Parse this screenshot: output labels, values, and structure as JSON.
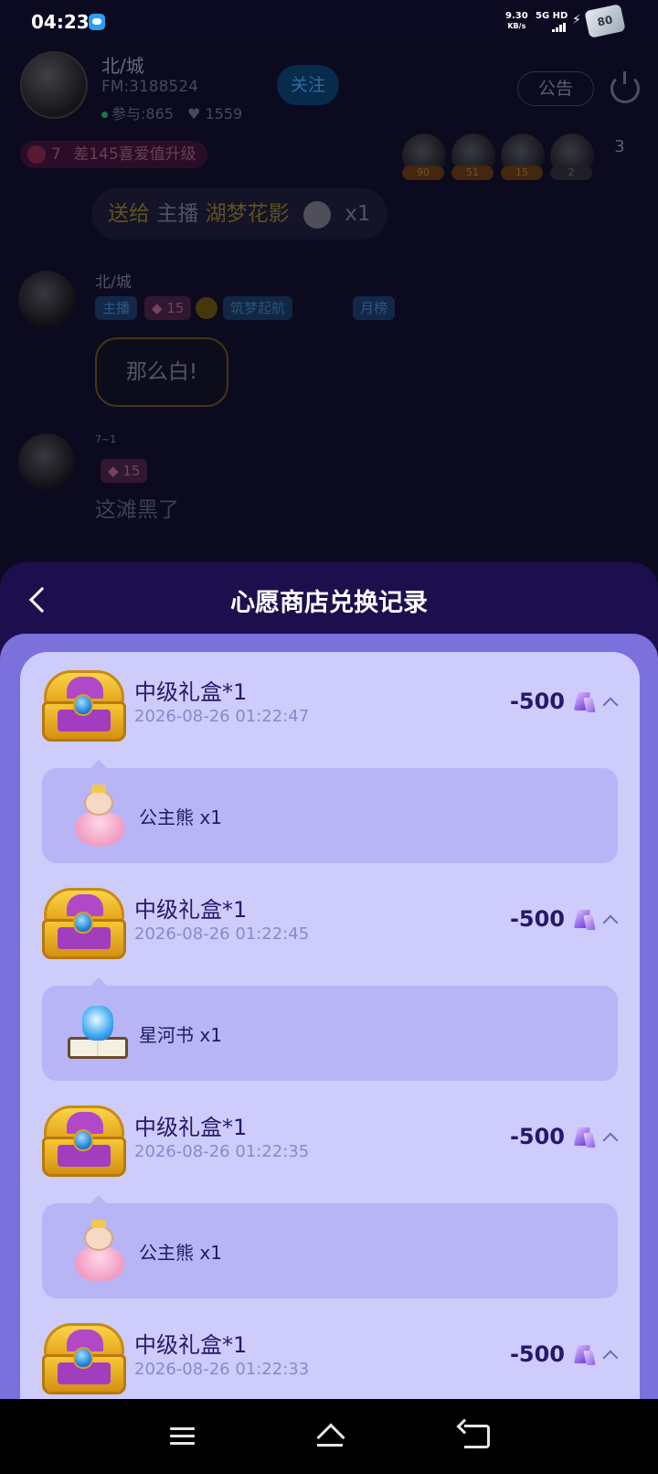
{
  "status_bar": {
    "time": "04:23",
    "net_speed": "9.30",
    "net_unit": "KB/s",
    "net_type": "5G HD",
    "battery": "80"
  },
  "room": {
    "host_name": "北/城",
    "fm": "FM:3188524",
    "participants": "参与:865",
    "likes": "1559",
    "follow_label": "关注",
    "notice_label": "公告",
    "level_value": "7",
    "level_text": "差145喜爱值升级",
    "viewers": [
      {
        "badge": "90"
      },
      {
        "badge": "51"
      },
      {
        "badge": "15"
      },
      {
        "badge": "2"
      }
    ],
    "viewer_count": "3",
    "gift_message": {
      "prefix": "送给",
      "role": "主播",
      "target": "湖梦花影",
      "qty": "x1"
    },
    "chat": [
      {
        "name": "北/城",
        "tags": [
          "主播",
          "15",
          "筑梦起航",
          "月榜"
        ],
        "message": "那么白!"
      },
      {
        "name": "7~1",
        "tags": [
          "15"
        ],
        "message": "这滩黑了"
      }
    ]
  },
  "sheet": {
    "title": "心愿商店兑换记录",
    "records": [
      {
        "title": "中级礼盒*1",
        "time": "2026-08-26 01:22:47",
        "cost": "-500",
        "reward": "公主熊 x1",
        "reward_icon": "princess-bear"
      },
      {
        "title": "中级礼盒*1",
        "time": "2026-08-26 01:22:45",
        "cost": "-500",
        "reward": "星河书 x1",
        "reward_icon": "galaxy-book"
      },
      {
        "title": "中级礼盒*1",
        "time": "2026-08-26 01:22:35",
        "cost": "-500",
        "reward": "公主熊 x1",
        "reward_icon": "princess-bear"
      },
      {
        "title": "中级礼盒*1",
        "time": "2026-08-26 01:22:33",
        "cost": "-500"
      }
    ]
  },
  "colors": {
    "sheet_header": "#1d0f4e",
    "sheet_frame": "#7c70dc",
    "list_bg": "#cdccfb",
    "reward_bg": "#b7b5f6",
    "text_primary": "#26186a"
  }
}
